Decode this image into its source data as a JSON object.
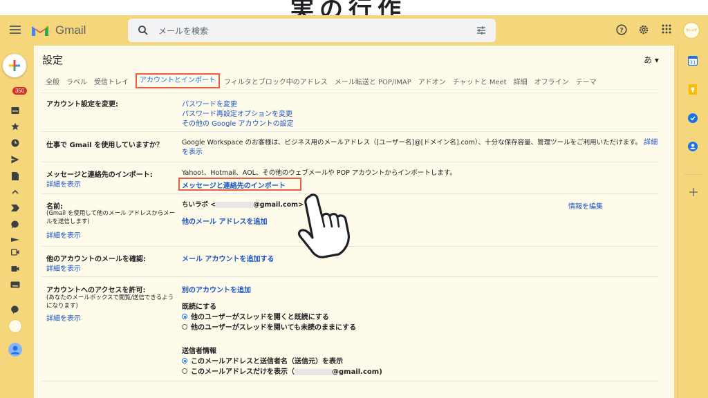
{
  "overlay": {
    "title": "実の行作"
  },
  "header": {
    "brand": "Gmail",
    "search_placeholder": "メールを検索",
    "avatar_text": "ちいラボ"
  },
  "left_rail": {
    "badge": "350"
  },
  "page": {
    "title": "設定",
    "lang": "あ ▾",
    "tabs": [
      "全般",
      "ラベル",
      "受信トレイ",
      "アカウントとインポート",
      "フィルタとブロック中のアドレス",
      "メール転送と POP/IMAP",
      "アドオン",
      "チャットと Meet",
      "詳細",
      "オフライン",
      "テーマ"
    ]
  },
  "rows": {
    "change": {
      "label": "アカウント設定を変更:",
      "links": [
        "パスワードを変更",
        "パスワード再設定オプションを変更",
        "その他の Google アカウントの設定"
      ]
    },
    "work": {
      "label": "仕事で Gmail を使用していますか？",
      "text": "Google Workspace のお客様は、ビジネス用のメールアドレス（[ユーザー名]@[ドメイン名].com）、十分な保存容量、管理ツールをご利用いただけます。",
      "link": "詳細を表示"
    },
    "import": {
      "label": "メッセージと連絡先のインポート:",
      "sub_link": "詳細を表示",
      "text": "Yahoo!、Hotmail、AOL、その他のウェブメールや POP アカウントからインポートします。",
      "action": "メッセージと連絡先のインポート"
    },
    "name": {
      "label": "名前:",
      "sub": "(Gmail を使用して他のメール アドレスからメールを送信します)",
      "sub_link": "詳細を表示",
      "sender_name": "ちいラボ <",
      "sender_domain": "@gmail.com>",
      "add_link": "他のメール アドレスを追加",
      "edit_link": "情報を編集"
    },
    "check": {
      "label": "他のアカウントのメールを確認:",
      "sub_link": "詳細を表示",
      "action": "メール アカウントを追加する"
    },
    "grant": {
      "label": "アカウントへのアクセスを許可:",
      "sub": "(あなたのメールボックスで閲覧/送信できるようになります)",
      "sub_link": "詳細を表示",
      "action": "別のアカウントを追加",
      "read_title": "既読にする",
      "read_opt1": "他のユーザーがスレッドを開くと既読にする",
      "read_opt2": "他のユーザーがスレッドを開いても未読のままにする",
      "sender_title": "送信者情報",
      "sender_opt1": "このメールアドレスと送信者名（送信元）を表示",
      "sender_opt2_prefix": "このメールアドレスだけを表示（",
      "sender_opt2_suffix": "@gmail.com)"
    }
  },
  "colors": {
    "frame": "#f6d67a",
    "highlight": "#ea5f44",
    "link": "#1a55c7"
  }
}
